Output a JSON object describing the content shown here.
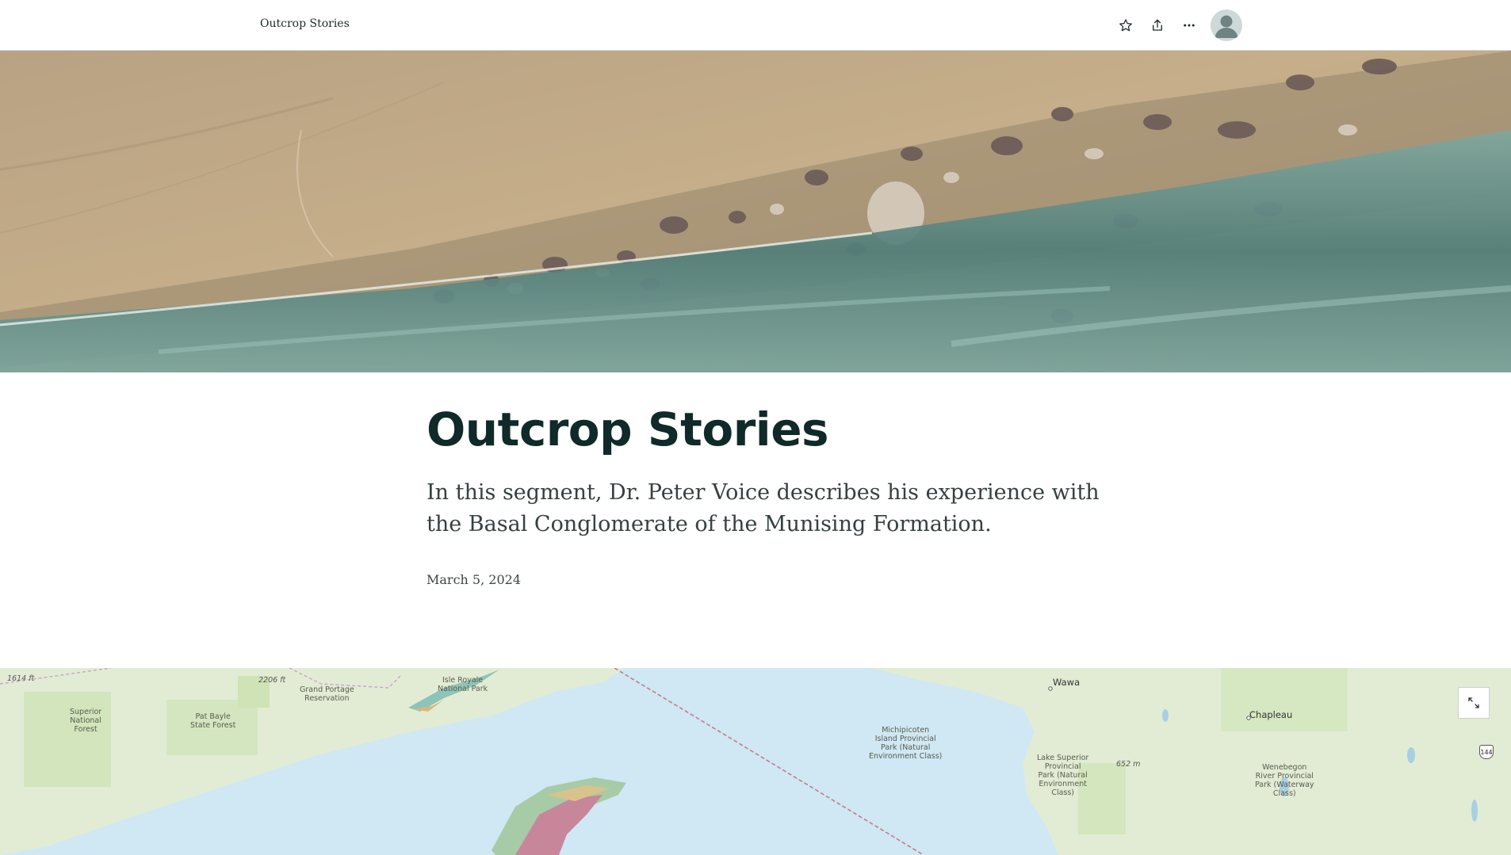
{
  "header": {
    "brand": "Outcrop Stories",
    "icons": [
      "star-icon",
      "share-icon",
      "more-options-icon",
      "user-avatar-icon"
    ]
  },
  "hero": {
    "icon": "conglomerate-outcrop-photo"
  },
  "story": {
    "title": "Outcrop Stories",
    "subtitle": "In this segment, Dr. Peter Voice describes his experience with the Basal Conglomerate of the Munising Formation.",
    "date": "March 5, 2024"
  },
  "map": {
    "labels": {
      "elev_1614": "1614 ft",
      "elev_2206": "2206 ft",
      "grand_portage": "Grand Portage\nReservation",
      "isle_royale": "Isle Royale\nNational Park",
      "superior_nf": "Superior\nNational\nForest",
      "pat_bayle": "Pat Bayle\nState Forest",
      "michipicoten": "Michipicoten\nIsland Provincial\nPark (Natural\nEnvironment Class)",
      "wawa": "Wawa",
      "chapleau": "Chapleau",
      "lake_superior_pp": "Lake Superior\nProvincial\nPark (Natural\nEnvironment\nClass)",
      "elev_652": "652 m",
      "wenebegon": "Wenebegon\nRiver Provincial\nPark (Waterway\nClass)",
      "route_144": "144"
    },
    "expand_icon": "expand-icon"
  },
  "colors": {
    "title": "#0f2a28",
    "water": "#cfe8f3",
    "land": "#e3edd6",
    "forest": "#cfe3b6"
  }
}
